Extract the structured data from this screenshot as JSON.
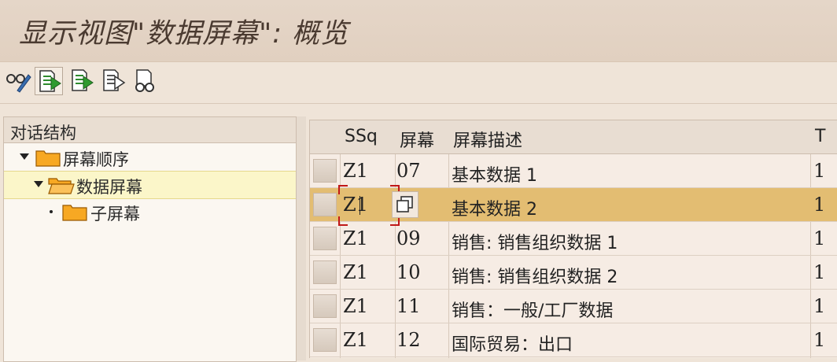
{
  "window": {
    "title": "显示视图\"数据屏幕\": 概览"
  },
  "toolbar": {
    "buttons": [
      "display-change-icon",
      "screen-detail-icon",
      "screen-next-icon",
      "screen-copy-icon",
      "glasses-icon"
    ]
  },
  "tree": {
    "header": "对话结构",
    "items": [
      {
        "label": "屏幕顺序",
        "level": 0,
        "expanded": true
      },
      {
        "label": "数据屏幕",
        "level": 1,
        "expanded": true,
        "selected": true
      },
      {
        "label": "子屏幕",
        "level": 2,
        "expanded": false
      }
    ]
  },
  "table": {
    "columns": [
      "SSq",
      "屏幕",
      "屏幕描述",
      "T"
    ],
    "rows": [
      {
        "ssq": "Z1",
        "screen": "07",
        "desc": "基本数据 1",
        "t": "1",
        "selected": false
      },
      {
        "ssq": "Z1",
        "screen": "",
        "desc": "基本数据 2",
        "t": "1",
        "selected": true
      },
      {
        "ssq": "Z1",
        "screen": "09",
        "desc": "销售: 销售组织数据 1",
        "t": "1",
        "selected": false
      },
      {
        "ssq": "Z1",
        "screen": "10",
        "desc": "销售: 销售组织数据 2",
        "t": "1",
        "selected": false
      },
      {
        "ssq": "Z1",
        "screen": "11",
        "desc": "销售：一般/工厂数据",
        "t": "1",
        "selected": false
      },
      {
        "ssq": "Z1",
        "screen": "12",
        "desc": "国际贸易：出口",
        "t": "1",
        "selected": false
      }
    ]
  },
  "colors": {
    "selected_row": "#e3bd72",
    "selected_tree": "#fbf6c9",
    "folder": "#f5a623",
    "cursor_bracket": "#c01818"
  }
}
